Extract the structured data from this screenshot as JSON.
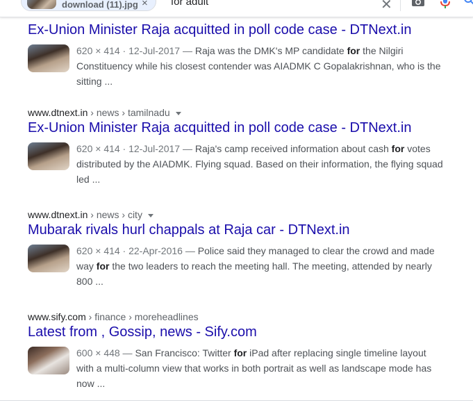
{
  "search": {
    "chip_label": "download (11).jpg",
    "chip_close": "×",
    "query": "for adult",
    "clear_glyph": "✕"
  },
  "icons": {
    "camera": "camera-icon",
    "mic": "mic-icon",
    "search": "search-icon",
    "close": "close-icon"
  },
  "colors": {
    "title_link": "#1a0dab",
    "snippet_text": "#4d5156",
    "meta_text": "#70757a",
    "mic_blue": "#4285f4",
    "mic_red": "#ea4335"
  },
  "results": [
    {
      "cite_domain": "",
      "cite_path": "",
      "title": "Ex-Union Minister Raja acquitted in poll code case - DTNext.in",
      "meta": "620 × 414 · 12-Jul-2017 —",
      "pre": " Raja was the DMK's MP candidate ",
      "bold": "for",
      "post": " the Nilgiri Constituency while his closest contender was AIADMK C Gopalakrishnan, who is the sitting ..."
    },
    {
      "cite_domain": "www.dtnext.in",
      "cite_path": " › news › tamilnadu",
      "title": "Ex-Union Minister Raja acquitted in poll code case - DTNext.in",
      "meta": "620 × 414 · 12-Jul-2017 —",
      "pre": " Raja's camp received information about cash ",
      "bold": "for",
      "post": " votes distributed by the AIADMK. Flying squad. Based on their information, the flying squad led ..."
    },
    {
      "cite_domain": "www.dtnext.in",
      "cite_path": " › news › city",
      "title": "Mubarak rivals hurl chappals at Raja car - DTNext.in",
      "meta": "620 × 414 · 22-Apr-2016 —",
      "pre": " Police said they managed to clear the crowd and made way ",
      "bold": "for",
      "post": " the two leaders to reach the meeting hall. The meeting, attended by nearly 800 ..."
    },
    {
      "cite_domain": "www.sify.com",
      "cite_path": " › finance › moreheadlines",
      "title": "Latest from , Gossip, news - Sify.com",
      "meta": "600 × 448 —",
      "pre": " San Francisco: Twitter ",
      "bold": "for",
      "post": " iPad after replacing single timeline layout with a multi-column view that works in both portrait as well as landscape mode has now ..."
    }
  ]
}
